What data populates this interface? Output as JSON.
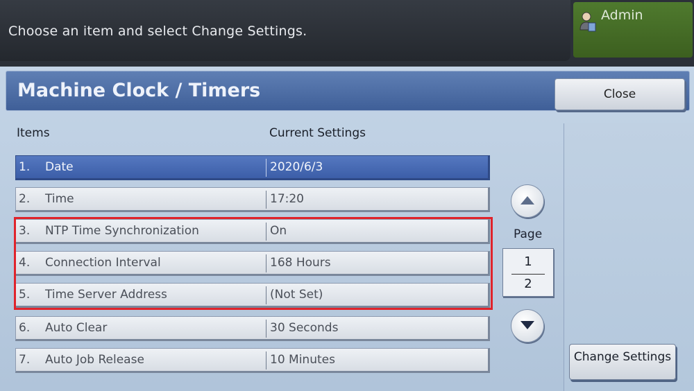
{
  "header": {
    "message": "Choose an item and select Change Settings.",
    "user_label": "Admin"
  },
  "screen": {
    "title": "Machine Clock / Timers",
    "close_label": "Close"
  },
  "table": {
    "columns": {
      "items": "Items",
      "current_settings": "Current Settings"
    },
    "rows": [
      {
        "num": "1.",
        "name": "Date",
        "value": "2020/6/3",
        "selected": true
      },
      {
        "num": "2.",
        "name": "Time",
        "value": "17:20",
        "selected": false
      },
      {
        "num": "3.",
        "name": "NTP Time Synchronization",
        "value": "On",
        "selected": false
      },
      {
        "num": "4.",
        "name": "Connection Interval",
        "value": "168 Hours",
        "selected": false
      },
      {
        "num": "5.",
        "name": "Time Server Address",
        "value": "(Not Set)",
        "selected": false
      },
      {
        "num": "6.",
        "name": "Auto Clear",
        "value": "30 Seconds",
        "selected": false
      },
      {
        "num": "7.",
        "name": "Auto Job Release",
        "value": "10 Minutes",
        "selected": false
      }
    ]
  },
  "pagination": {
    "label": "Page",
    "current": "1",
    "total": "2"
  },
  "actions": {
    "change_settings_label": "Change Settings"
  },
  "colors": {
    "selected_row": "#4a6bb5",
    "highlight_box": "#e0232b",
    "admin_badge": "#4a7329"
  }
}
